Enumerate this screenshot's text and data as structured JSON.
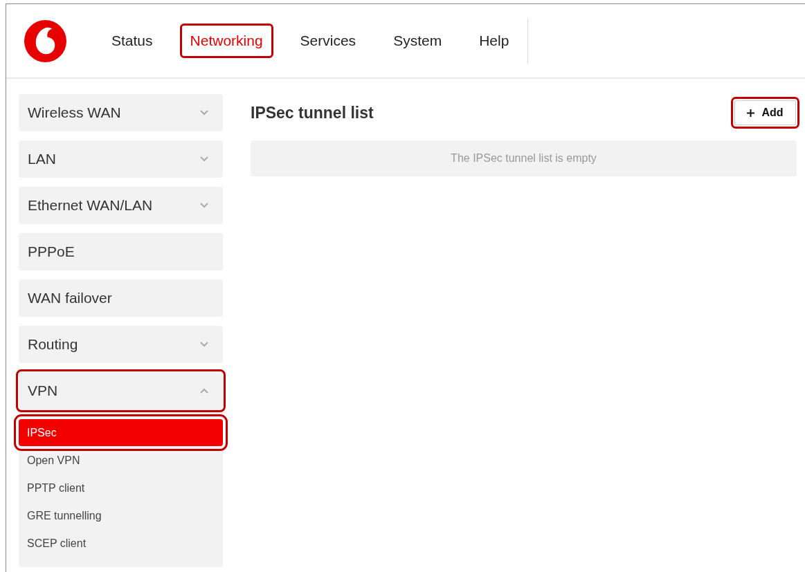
{
  "nav": {
    "tabs": [
      {
        "label": "Status",
        "selected": false,
        "highlighted": false
      },
      {
        "label": "Networking",
        "selected": true,
        "highlighted": true
      },
      {
        "label": "Services",
        "selected": false,
        "highlighted": false
      },
      {
        "label": "System",
        "selected": false,
        "highlighted": false
      },
      {
        "label": "Help",
        "selected": false,
        "highlighted": false
      }
    ]
  },
  "sidebar": {
    "items": [
      {
        "label": "Wireless WAN",
        "kind": "collapsed",
        "highlighted": false
      },
      {
        "label": "LAN",
        "kind": "collapsed",
        "highlighted": false
      },
      {
        "label": "Ethernet WAN/LAN",
        "kind": "collapsed",
        "highlighted": false
      },
      {
        "label": "PPPoE",
        "kind": "plain",
        "highlighted": false
      },
      {
        "label": "WAN failover",
        "kind": "plain",
        "highlighted": false
      },
      {
        "label": "Routing",
        "kind": "collapsed",
        "highlighted": false
      },
      {
        "label": "VPN",
        "kind": "expanded",
        "highlighted": true,
        "children": [
          {
            "label": "IPSec",
            "selected": true,
            "highlighted": true
          },
          {
            "label": "Open VPN",
            "selected": false,
            "highlighted": false
          },
          {
            "label": "PPTP client",
            "selected": false,
            "highlighted": false
          },
          {
            "label": "GRE tunnelling",
            "selected": false,
            "highlighted": false
          },
          {
            "label": "SCEP client",
            "selected": false,
            "highlighted": false
          }
        ]
      }
    ]
  },
  "main": {
    "title": "IPSec tunnel list",
    "add_button": {
      "label": "Add",
      "highlighted": true
    },
    "empty_message": "The IPSec tunnel list is empty"
  }
}
